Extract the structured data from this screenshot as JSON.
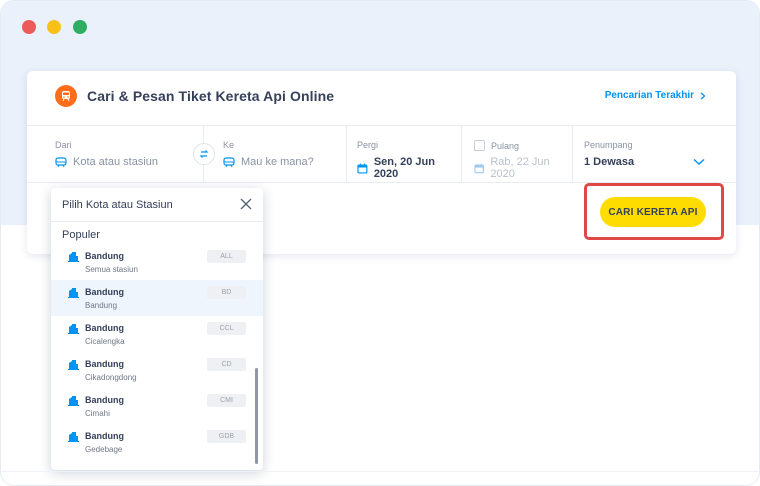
{
  "window": {
    "controls": [
      "close",
      "minimize",
      "maximize"
    ]
  },
  "header": {
    "title": "Cari & Pesan Tiket Kereta Api Online",
    "recent_link": "Pencarian Terakhir",
    "icon": "train-icon"
  },
  "fields": {
    "dari": {
      "label": "Dari",
      "placeholder": "Kota atau stasiun"
    },
    "ke": {
      "label": "Ke",
      "placeholder": "Mau ke mana?"
    },
    "pergi": {
      "label": "Pergi",
      "value": "Sen, 20 Jun 2020"
    },
    "pulang": {
      "label": "Pulang",
      "value": "Rab, 22 Jun 2020",
      "checked": false
    },
    "penumpang": {
      "label": "Penumpang",
      "value": "1 Dewasa"
    }
  },
  "search_button": {
    "label": "CARI KERETA API"
  },
  "dropdown": {
    "title": "Pilih Kota atau Stasiun",
    "section": "Populer",
    "items": [
      {
        "city": "Bandung",
        "station": "Semua stasiun",
        "code": "ALL"
      },
      {
        "city": "Bandung",
        "station": "Bandung",
        "code": "BD"
      },
      {
        "city": "Bandung",
        "station": "Cicalengka",
        "code": "CCL"
      },
      {
        "city": "Bandung",
        "station": "Cikadongdong",
        "code": "CD"
      },
      {
        "city": "Bandung",
        "station": "Cimahi",
        "code": "CMI"
      },
      {
        "city": "Bandung",
        "station": "Gedebage",
        "code": "GDB"
      }
    ]
  },
  "colors": {
    "accent_blue": "#0194f3",
    "brand_orange": "#ff6d1b",
    "button_yellow": "#ffdc00",
    "highlight_red": "#e04848"
  }
}
